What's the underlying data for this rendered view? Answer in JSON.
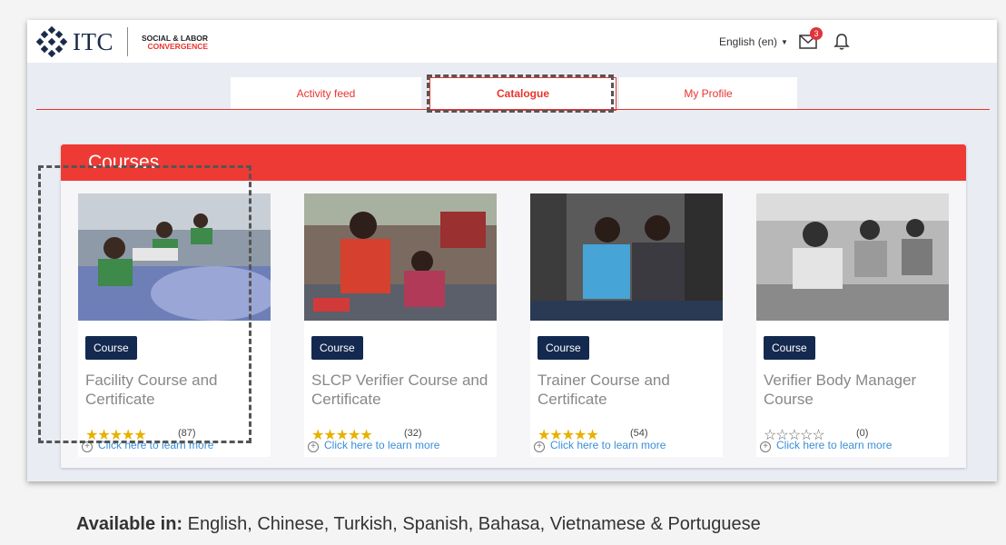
{
  "header": {
    "logo_text": "ITC",
    "partner_line1": "SOCIAL & LABOR",
    "partner_line2": "CONVERGENCE",
    "language": "English (en)",
    "mail_count": "3",
    "icons": [
      "logo-mark-icon",
      "mail-icon",
      "bell-icon"
    ]
  },
  "tabs": [
    {
      "label": "Activity feed"
    },
    {
      "label": "Catalogue"
    },
    {
      "label": "My Profile"
    }
  ],
  "section_title": "Courses",
  "courses": [
    {
      "badge": "Course",
      "title": "Facility Course and Certificate",
      "rating": 5,
      "count": "(87)",
      "link": "Click here to learn more"
    },
    {
      "badge": "Course",
      "title": "SLCP Verifier Course and Certificate",
      "rating": 5,
      "count": "(32)",
      "link": "Click here to learn more"
    },
    {
      "badge": "Course",
      "title": "Trainer Course and Certificate",
      "rating": 5,
      "count": "(54)",
      "link": "Click here to learn more"
    },
    {
      "badge": "Course",
      "title": "Verifier Body Manager Course",
      "rating": 0,
      "count": "(0)",
      "link": "Click here to learn more"
    }
  ],
  "footer": {
    "label": "Available in:",
    "languages": "English, Chinese, Turkish, Spanish, Bahasa, Vietnamese & Portuguese"
  },
  "colors": {
    "accent": "#ee3a34",
    "badge": "#14294f",
    "link": "#3a8fd8",
    "star": "#e8b000"
  }
}
